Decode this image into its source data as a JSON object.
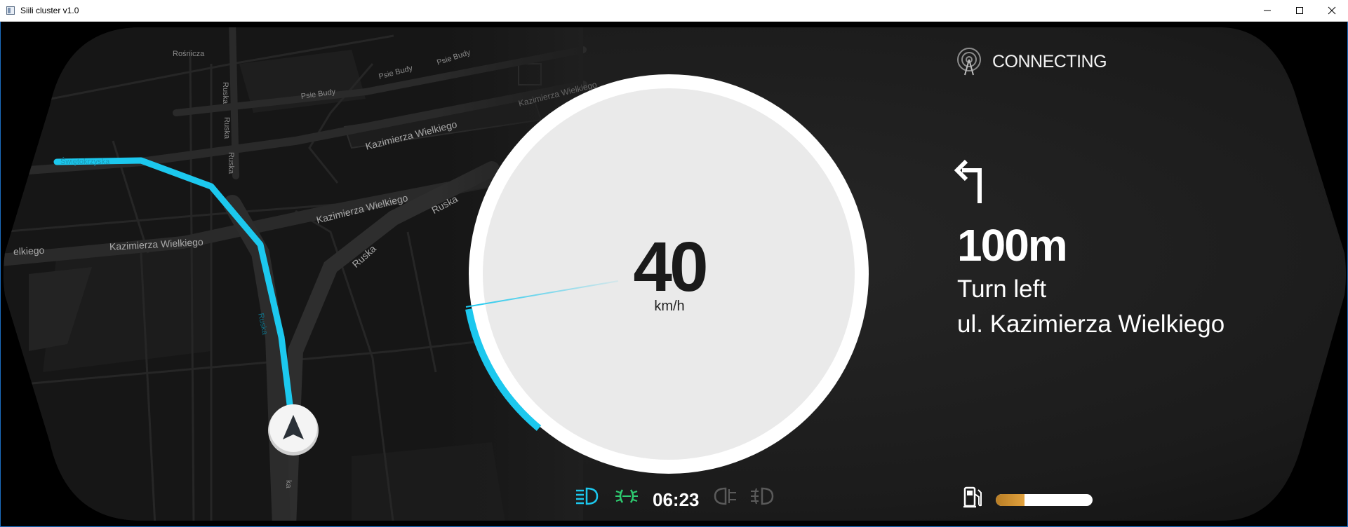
{
  "window": {
    "title": "Siili cluster v1.0"
  },
  "speedometer": {
    "speed": "40",
    "unit": "km/h",
    "accent_color": "#1cc8ee"
  },
  "connection": {
    "status": "CONNECTING",
    "icon": "antenna-icon"
  },
  "navigation": {
    "turn_icon": "turn-left-arrow-icon",
    "distance": "100m",
    "maneuver": "Turn left",
    "street": "ul. Kazimierza Wielkiego"
  },
  "map": {
    "route_color": "#1cc8ee",
    "labels": {
      "rosnicza": "Rośnicza",
      "psie_budy_1": "Psie Budy",
      "psie_budy_2": "Psie Budy",
      "psie_budy_3": "Psie Budy",
      "ruska_v1": "Ruska",
      "ruska_v2": "Ruska",
      "ruska_v3": "Ruska",
      "kazimierza_1": "Kazimierza Wielkiego",
      "kazimierza_2": "Kazimierza Wielkiego",
      "kazimierza_3": "Kazimierza Wielkiego",
      "kazimierza_4": "Kazimierza Wielkiego",
      "kazimierza_5": "elkiego",
      "ruska_d1": "Ruska",
      "ruska_d2": "Ruska",
      "swietokrzyska": "Świętokrzyska",
      "ruska_route": "Ruska",
      "ruska_bottom": "ka"
    }
  },
  "status_bar": {
    "clock": "06:23",
    "telltales": [
      {
        "name": "low-beam-icon",
        "color": "#1cc8ee",
        "active": true
      },
      {
        "name": "parking-lights-icon",
        "color": "#2ecc71",
        "active": true
      },
      {
        "name": "left-indicator-icon",
        "color": "#5a5a5a",
        "active": false
      },
      {
        "name": "fog-light-icon",
        "color": "#5a5a5a",
        "active": false
      }
    ],
    "fuel_icon": "fuel-pump-icon",
    "fuel_level": 0.3
  }
}
